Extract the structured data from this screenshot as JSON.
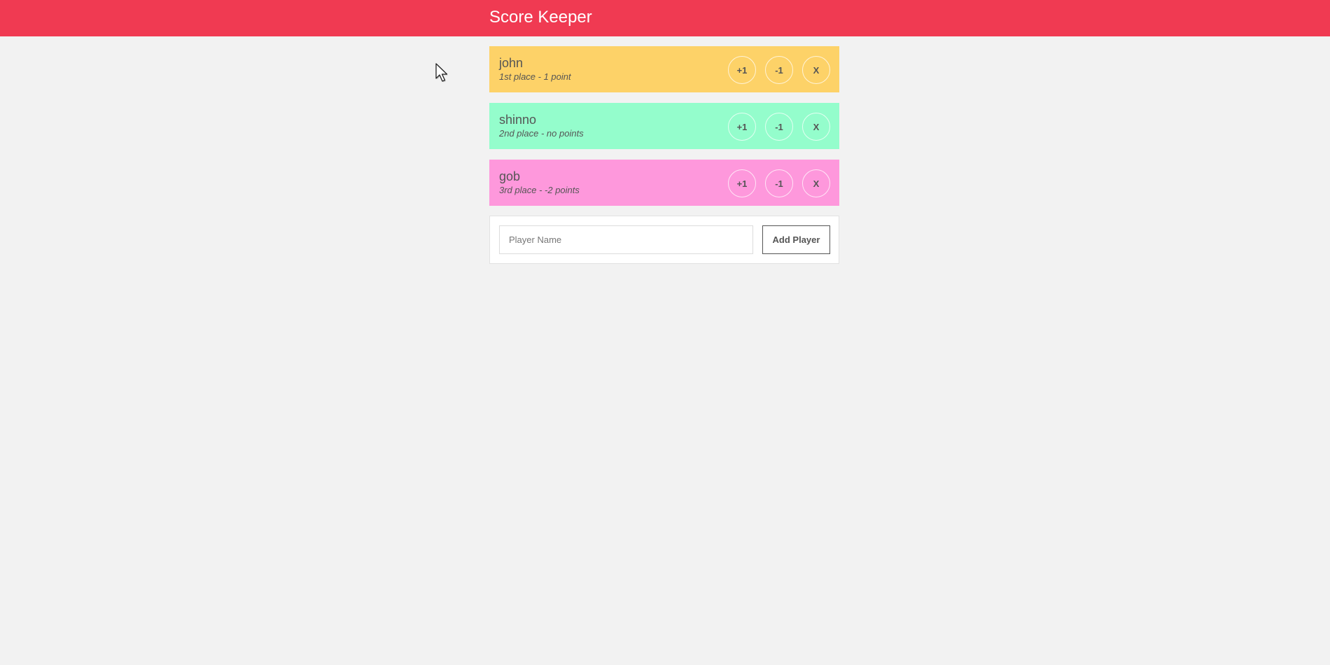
{
  "header": {
    "title": "Score Keeper",
    "color": "#f03a52"
  },
  "players": [
    {
      "name": "john",
      "status": "1st place - 1 point",
      "color": "#fdd268",
      "plus_label": "+1",
      "minus_label": "-1",
      "remove_label": "X"
    },
    {
      "name": "shinno",
      "status": "2nd place - no points",
      "color": "#94fdcc",
      "plus_label": "+1",
      "minus_label": "-1",
      "remove_label": "X"
    },
    {
      "name": "gob",
      "status": "3rd place - -2 points",
      "color": "#fe98dc",
      "plus_label": "+1",
      "minus_label": "-1",
      "remove_label": "X"
    }
  ],
  "add_form": {
    "input_value": "",
    "input_placeholder": "Player Name",
    "button_label": "Add Player"
  },
  "icons": {
    "cursor": "mouse-pointer-icon"
  }
}
